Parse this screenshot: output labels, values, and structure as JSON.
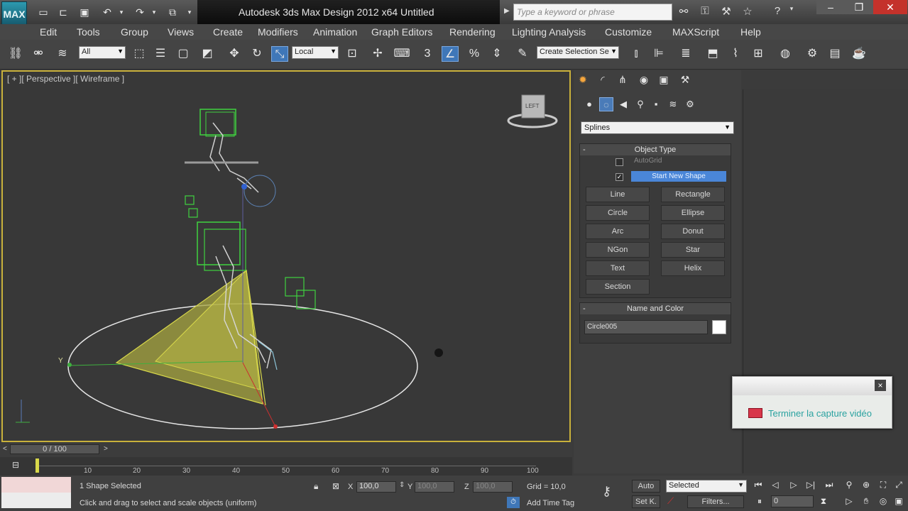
{
  "title_bar": {
    "app_logo": "MAX",
    "title": "Autodesk 3ds Max Design 2012 x64     Untitled",
    "search_placeholder": "Type a keyword or phrase"
  },
  "menu": [
    "Edit",
    "Tools",
    "Group",
    "Views",
    "Create",
    "Modifiers",
    "Animation",
    "Graph Editors",
    "Rendering",
    "Lighting Analysis",
    "Customize",
    "MAXScript",
    "Help"
  ],
  "toolbar": {
    "selection_filter": "All",
    "ref_coord": "Local",
    "snap_number": "3",
    "named_selection": "Create Selection Se"
  },
  "viewport": {
    "label": "[ + ][ Perspective ][ Wireframe ]",
    "viewcube_label": "LEFT",
    "axis_y_label": "Y"
  },
  "command_panel": {
    "category": "Splines",
    "object_type": {
      "header": "Object Type",
      "autogrid": "AutoGrid",
      "start_new_shape": "Start New Shape",
      "buttons": [
        "Line",
        "Rectangle",
        "Circle",
        "Ellipse",
        "Arc",
        "Donut",
        "NGon",
        "Star",
        "Text",
        "Helix",
        "Section"
      ]
    },
    "name_and_color": {
      "header": "Name and Color",
      "name_value": "Circle005",
      "color": "#ffffff"
    }
  },
  "notification": {
    "text": "Terminer la capture vidéo",
    "close": "×"
  },
  "timeline": {
    "frame_indicator": "0 / 100",
    "ticks": [
      "10",
      "20",
      "30",
      "40",
      "50",
      "60",
      "70",
      "80",
      "90",
      "100"
    ]
  },
  "status": {
    "selection_info": "1 Shape Selected",
    "prompt": "Click and drag to select and scale objects (uniform)",
    "x_label": "X",
    "x_value": "100,0",
    "y_label": "Y",
    "y_value": "100,0",
    "z_label": "Z",
    "z_value": "100,0",
    "grid": "Grid = 10,0",
    "add_time_tag": "Add Time Tag",
    "auto_key": "Auto",
    "set_key": "Set K.",
    "key_mode": "Selected",
    "filters": "Filters...",
    "current_frame": "0"
  },
  "colors": {
    "viewport_border": "#c9b13b",
    "helper_green": "#3fd23f",
    "spline_yellow": "#d8d84a",
    "notify_text": "#2aa2a0"
  }
}
